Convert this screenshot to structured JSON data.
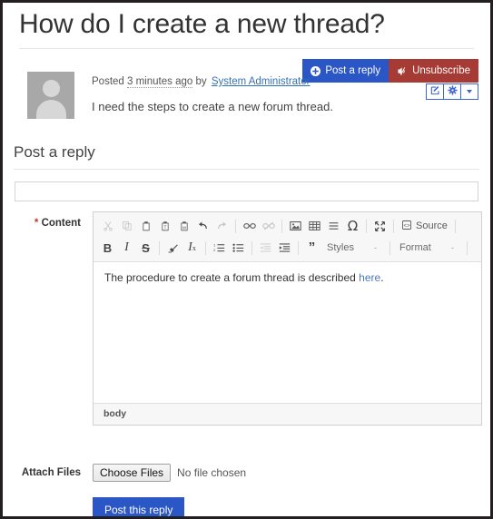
{
  "page": {
    "title": "How do I create a new thread?"
  },
  "actions": {
    "post_reply_label": "Post a reply",
    "post_reply_icon": "plus-circle-icon",
    "unsubscribe_label": "Unsubscribe",
    "unsubscribe_icon": "speaker-mute-icon",
    "edit_icon": "edit-square-icon",
    "settings_icon": "gear-icon",
    "more_icon": "chevron-down-icon",
    "primary_color": "#2a56c6",
    "danger_color": "#a63a34",
    "icon_button_border_color": "#3d64d4"
  },
  "post": {
    "avatar_icon": "user-avatar",
    "posted_prefix": "Posted",
    "time_ago": "3 minutes ago",
    "by_word": "by",
    "author": "System Administrator",
    "author_color": "#3572b0",
    "message": "I need the steps to create a new forum thread."
  },
  "reply_section": {
    "heading": "Post a reply",
    "subject_value": "",
    "subject_placeholder": "",
    "content_label": "Content",
    "required_marker": "*",
    "required_color": "#c0392b"
  },
  "editor": {
    "toolbar_row1": [
      {
        "name": "cut-icon",
        "glyph": "✂",
        "dim": true
      },
      {
        "name": "copy-icon",
        "glyph": "❐",
        "dim": true
      },
      {
        "name": "paste-icon",
        "glyph": "ὌB",
        "dim": false
      },
      {
        "name": "paste-text-icon",
        "glyph": "T",
        "dim": false
      },
      {
        "name": "paste-from-word-icon",
        "glyph": "W",
        "dim": false
      },
      {
        "name": "separator",
        "glyph": "",
        "dim": false
      },
      {
        "name": "undo-icon",
        "glyph": "←",
        "dim": false
      },
      {
        "name": "redo-icon",
        "glyph": "→",
        "dim": true
      },
      {
        "name": "separator",
        "glyph": "",
        "dim": false
      },
      {
        "name": "link-icon",
        "glyph": "⚭",
        "dim": false
      },
      {
        "name": "unlink-icon",
        "glyph": "⚭",
        "dim": true
      },
      {
        "name": "separator",
        "glyph": "",
        "dim": false
      },
      {
        "name": "image-icon",
        "glyph": "ὛC",
        "dim": false
      },
      {
        "name": "table-icon",
        "glyph": "▦",
        "dim": false
      },
      {
        "name": "horizontal-rule-icon",
        "glyph": "≡",
        "dim": false
      },
      {
        "name": "special-character-icon",
        "glyph": "Ω",
        "dim": false
      },
      {
        "name": "separator",
        "glyph": "",
        "dim": false
      },
      {
        "name": "maximize-icon",
        "glyph": "⤨",
        "dim": false
      },
      {
        "name": "separator",
        "glyph": "",
        "dim": false
      },
      {
        "name": "source-icon",
        "glyph": "<>",
        "dim": false
      }
    ],
    "source_label": "Source",
    "toolbar_row2": [
      {
        "name": "bold-icon",
        "glyph": "B",
        "dim": false
      },
      {
        "name": "italic-icon",
        "glyph": "I",
        "dim": false
      },
      {
        "name": "strikethrough-icon",
        "glyph": "S",
        "dim": false
      },
      {
        "name": "separator",
        "glyph": "",
        "dim": false
      },
      {
        "name": "remove-format-icon",
        "glyph": "✦",
        "dim": false
      },
      {
        "name": "subscript-icon",
        "glyph": "Ix",
        "dim": false
      },
      {
        "name": "separator",
        "glyph": "",
        "dim": false
      },
      {
        "name": "numbered-list-icon",
        "glyph": "≡",
        "dim": false
      },
      {
        "name": "bulleted-list-icon",
        "glyph": "☰",
        "dim": false
      },
      {
        "name": "separator",
        "glyph": "",
        "dim": false
      },
      {
        "name": "decrease-indent-icon",
        "glyph": "⇤",
        "dim": true
      },
      {
        "name": "increase-indent-icon",
        "glyph": "⇥",
        "dim": false
      },
      {
        "name": "separator",
        "glyph": "",
        "dim": false
      },
      {
        "name": "blockquote-icon",
        "glyph": "”",
        "dim": false
      }
    ],
    "styles_label": "Styles",
    "format_label": "Format",
    "combo_arrow": "-",
    "content_text_before_link": "The procedure to create a forum thread is described ",
    "content_link_text": "here",
    "content_text_after_link": ".",
    "footer_path": "body"
  },
  "attach": {
    "label": "Attach Files",
    "button_label": "Choose Files",
    "status_text": "No file chosen"
  },
  "submit": {
    "label": "Post this reply"
  }
}
